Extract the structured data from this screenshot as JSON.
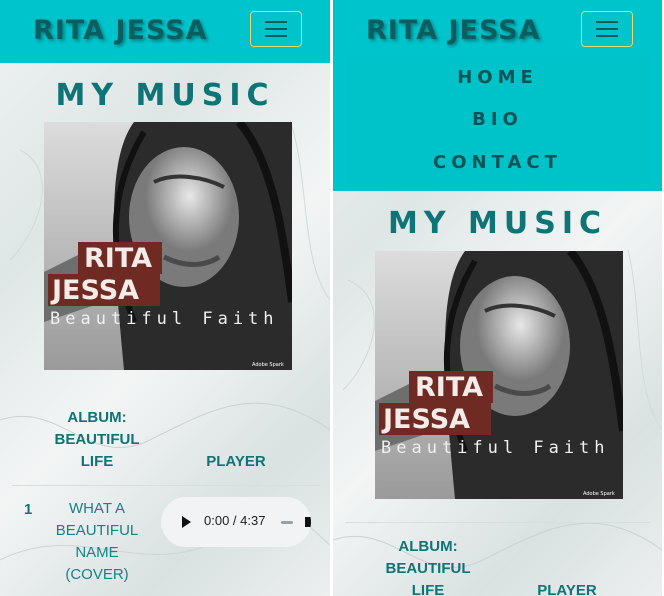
{
  "brand": "RITA JESSA",
  "nav": {
    "items": [
      "HOME",
      "BIO",
      "CONTACT"
    ]
  },
  "section_title": "MY MUSIC",
  "album_cover": {
    "artist_line1": "RITA",
    "artist_line2": "JESSA",
    "subtitle": "Beautiful Faith",
    "watermark": "Adobe Spark"
  },
  "table": {
    "col_album_line1": "ALBUM:",
    "col_album_line2": "BEAUTIFUL",
    "col_album_line3": "LIFE",
    "col_player": "PLAYER"
  },
  "track": {
    "number": "1",
    "title_line1": "WHAT A",
    "title_line2": "BEAUTIFUL",
    "title_line3": "NAME",
    "title_line4": "(COVER)",
    "time": "0:00 / 4:37"
  },
  "colors": {
    "navbar": "#00c4cb",
    "brand_text": "#0b5e60",
    "heading": "#0e7475",
    "toggler_border": "#f1d36a"
  },
  "icons": {
    "toggler": "hamburger-icon",
    "play": "play-icon",
    "volume": "volume-icon"
  }
}
